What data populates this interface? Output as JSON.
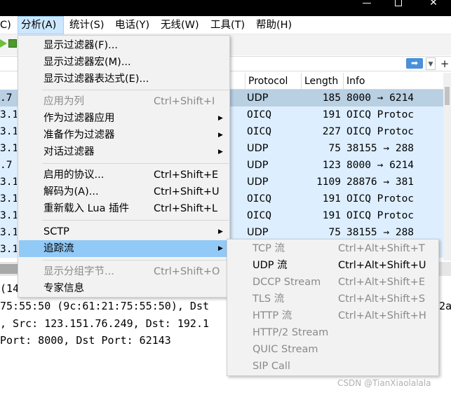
{
  "window": {
    "minimize": "—",
    "close": "✕"
  },
  "menubar": {
    "items": [
      {
        "label": "C)"
      },
      {
        "label": "分析(A)"
      },
      {
        "label": "统计(S)"
      },
      {
        "label": "电话(Y)"
      },
      {
        "label": "无线(W)"
      },
      {
        "label": "工具(T)"
      },
      {
        "label": "帮助(H)"
      }
    ]
  },
  "filter": {
    "value": "",
    "apply_icon": "➡",
    "dropdown_icon": "▼",
    "add_icon": "+"
  },
  "packet_list": {
    "columns": [
      "Protocol",
      "Length",
      "Info"
    ],
    "rows": [
      {
        "src": ".7",
        "protocol": "UDP",
        "length": "185",
        "info": "8000 → 6214"
      },
      {
        "src": "3.1",
        "protocol": "OICQ",
        "length": "191",
        "info": "OICQ Protoc"
      },
      {
        "src": "3.1",
        "protocol": "OICQ",
        "length": "227",
        "info": "OICQ Protoc"
      },
      {
        "src": "3.1",
        "protocol": "UDP",
        "length": "75",
        "info": "38155 → 288"
      },
      {
        "src": ".7",
        "protocol": "UDP",
        "length": "123",
        "info": "8000 → 6214"
      },
      {
        "src": "3.1",
        "protocol": "UDP",
        "length": "1109",
        "info": "28876 → 381"
      },
      {
        "src": "3.1",
        "protocol": "OICQ",
        "length": "191",
        "info": "OICQ Protoc"
      },
      {
        "src": "3.1",
        "protocol": "OICQ",
        "length": "191",
        "info": "OICQ Protoc"
      },
      {
        "src": "3.1",
        "protocol": "UDP",
        "length": "75",
        "info": "38155 → 288"
      },
      {
        "src": "3.1",
        "protocol": "",
        "length": "",
        "info": ""
      }
    ]
  },
  "details": {
    "lines": [
      "(14",
      "75:55:50 (9c:61:21:75:55:50), Dst",
      ", Src: 123.151.76.249, Dst: 192.1",
      " Port: 8000, Dst Port: 62143"
    ],
    "line2_tail": "2a"
  },
  "analyze_menu": {
    "items": [
      {
        "label": "显示过滤器(F)...",
        "shortcut": "",
        "disabled": false
      },
      {
        "label": "显示过滤器宏(M)...",
        "shortcut": "",
        "disabled": false
      },
      {
        "label": "显示过滤器表达式(E)...",
        "shortcut": "",
        "disabled": false
      },
      {
        "label": "应用为列",
        "shortcut": "Ctrl+Shift+I",
        "disabled": true
      },
      {
        "label": "作为过滤器应用",
        "shortcut": "",
        "disabled": false
      },
      {
        "label": "准备作为过滤器",
        "shortcut": "",
        "disabled": false
      },
      {
        "label": "对话过滤器",
        "shortcut": "",
        "disabled": false
      },
      {
        "label": "启用的协议...",
        "shortcut": "Ctrl+Shift+E",
        "disabled": false
      },
      {
        "label": "解码为(A)...",
        "shortcut": "Ctrl+Shift+U",
        "disabled": false
      },
      {
        "label": "重新载入 Lua 插件",
        "shortcut": "Ctrl+Shift+L",
        "disabled": false
      },
      {
        "label": "SCTP",
        "shortcut": "",
        "disabled": false
      },
      {
        "label": "追踪流",
        "shortcut": "",
        "disabled": false
      },
      {
        "label": "显示分组字节...",
        "shortcut": "Ctrl+Shift+O",
        "disabled": true
      },
      {
        "label": "专家信息",
        "shortcut": "",
        "disabled": false
      }
    ],
    "submenu_arrow": "▶"
  },
  "follow_menu": {
    "items": [
      {
        "label": "TCP 流",
        "shortcut": "Ctrl+Alt+Shift+T",
        "disabled": true
      },
      {
        "label": "UDP 流",
        "shortcut": "Ctrl+Alt+Shift+U",
        "disabled": false
      },
      {
        "label": "DCCP Stream",
        "shortcut": "Ctrl+Alt+Shift+E",
        "disabled": true
      },
      {
        "label": "TLS 流",
        "shortcut": "Ctrl+Alt+Shift+S",
        "disabled": true
      },
      {
        "label": "HTTP 流",
        "shortcut": "Ctrl+Alt+Shift+H",
        "disabled": true
      },
      {
        "label": "HTTP/2 Stream",
        "shortcut": "",
        "disabled": true
      },
      {
        "label": "QUIC Stream",
        "shortcut": "",
        "disabled": true
      },
      {
        "label": "SIP Call",
        "shortcut": "",
        "disabled": true
      }
    ]
  },
  "watermark": "CSDN @TianXiaolalala",
  "colors": {
    "row_bg": "#ddeeff",
    "row_selected": "#b9cfe2",
    "menu_highlight": "#91c9f7",
    "menubar_active": "#cce8ff",
    "disabled_text": "#8a8a8a"
  }
}
